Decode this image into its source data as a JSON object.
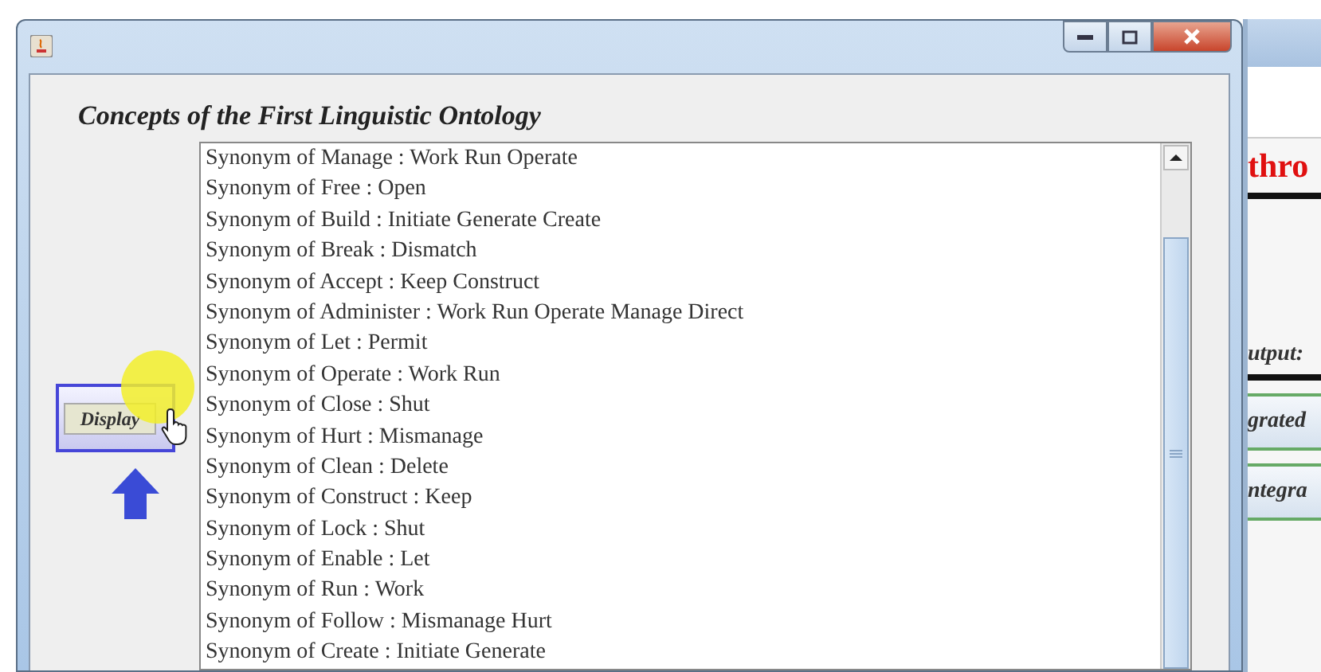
{
  "window": {
    "title": "Concepts of the First Linguistic Ontology"
  },
  "display_button": {
    "label": "Display"
  },
  "list": {
    "items": [
      "Synonym of Manage : Work Run Operate",
      "Synonym of Free : Open",
      "Synonym of Build : Initiate Generate Create",
      "Synonym of Break : Dismatch",
      "Synonym of Accept : Keep Construct",
      "Synonym of Administer : Work Run Operate Manage Direct",
      "Synonym of Let : Permit",
      "Synonym of Operate : Work Run",
      "Synonym of Close : Shut",
      "Synonym of Hurt : Mismanage",
      "Synonym of Clean : Delete",
      "Synonym of Construct : Keep",
      "Synonym of Lock : Shut",
      "Synonym of Enable : Let",
      "Synonym of Run : Work",
      "Synonym of Follow : Mismanage Hurt",
      "Synonym of Create : Initiate Generate"
    ]
  },
  "background_window": {
    "texts": [
      {
        "kind": "heading",
        "text": "thro"
      },
      {
        "kind": "label",
        "text": "utput:"
      },
      {
        "kind": "row",
        "text": "grated"
      },
      {
        "kind": "row",
        "text": "ntegra"
      }
    ]
  }
}
